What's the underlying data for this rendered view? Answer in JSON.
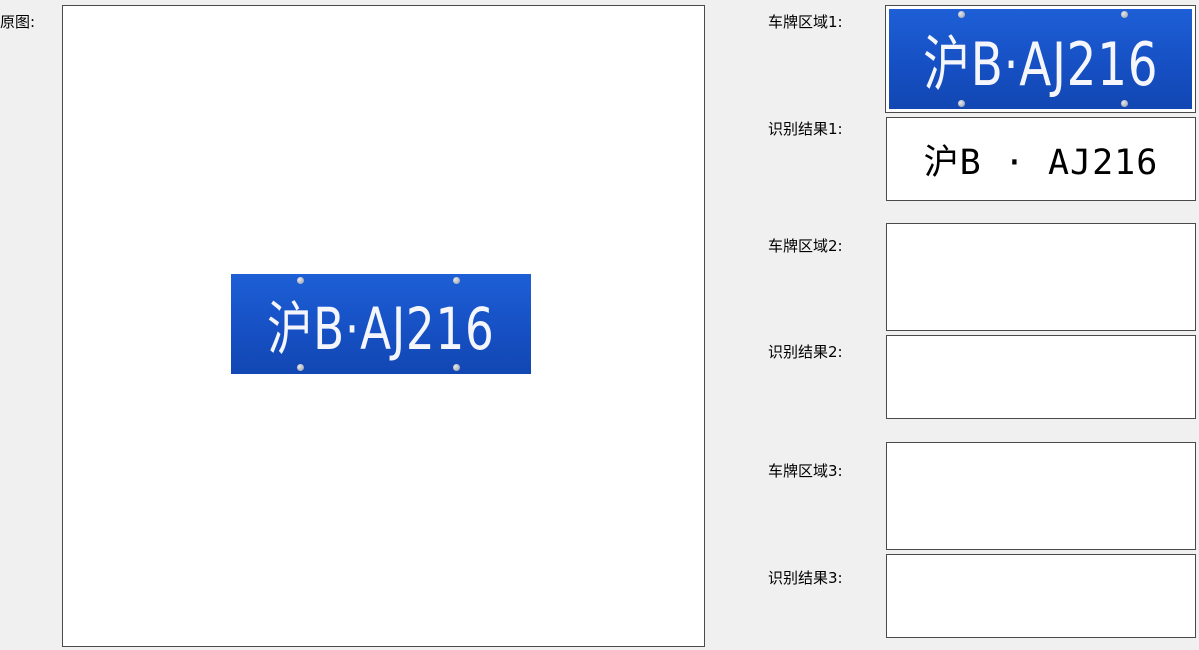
{
  "original": {
    "label": "原图:",
    "plate_text": "沪B·AJ216"
  },
  "slots": [
    {
      "region_label": "车牌区域1:",
      "plate_text": "沪B·AJ216",
      "result_label": "识别结果1:",
      "result_text": "沪B · AJ216"
    },
    {
      "region_label": "车牌区域2:",
      "plate_text": "",
      "result_label": "识别结果2:",
      "result_text": ""
    },
    {
      "region_label": "车牌区域3:",
      "plate_text": "",
      "result_label": "识别结果3:",
      "result_text": ""
    }
  ],
  "colors": {
    "plate_blue": "#1a56cc",
    "plate_character": "#f4f6fb",
    "window_background": "#f0f0f0"
  }
}
